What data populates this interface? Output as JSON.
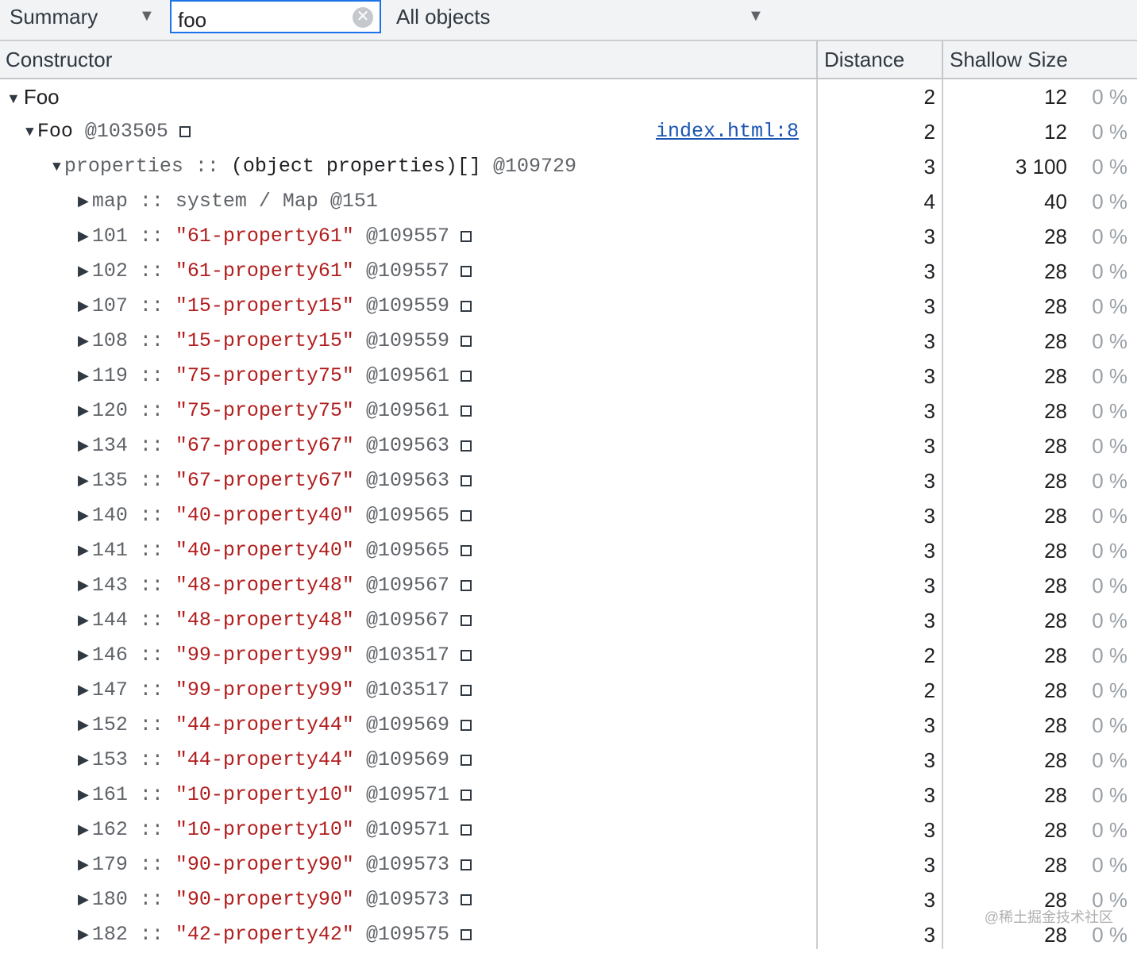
{
  "toolbar": {
    "view": "Summary",
    "filter_value": "foo",
    "class_filter": "All objects"
  },
  "columns": {
    "constructor": "Constructor",
    "distance": "Distance",
    "shallow_size": "Shallow Size"
  },
  "rows": [
    {
      "level": 0,
      "kind": "class",
      "expanded": true,
      "name": "Foo",
      "distance": "2",
      "size": "12",
      "pct": "0 %"
    },
    {
      "level": 1,
      "kind": "object",
      "expanded": true,
      "name": "Foo",
      "id": "@103505",
      "link": "index.html:8",
      "distance": "2",
      "size": "12",
      "pct": "0 %"
    },
    {
      "level": 2,
      "kind": "prop",
      "expanded": true,
      "key": "properties",
      "sep": " :: ",
      "value": "(object properties)[]",
      "value_color": "dark",
      "id": "@109729",
      "box": false,
      "distance": "3",
      "size": "3 100",
      "pct": "0 %"
    },
    {
      "level": 3,
      "kind": "prop",
      "expanded": false,
      "key": "map",
      "sep": " :: ",
      "value": "system / Map",
      "value_color": "grey",
      "id": "@151",
      "box": false,
      "distance": "4",
      "size": "40",
      "pct": "0 %"
    },
    {
      "level": 3,
      "kind": "prop",
      "expanded": false,
      "key": "101",
      "sep": " :: ",
      "value": "\"61-property61\"",
      "value_color": "red",
      "id": "@109557",
      "box": true,
      "distance": "3",
      "size": "28",
      "pct": "0 %"
    },
    {
      "level": 3,
      "kind": "prop",
      "expanded": false,
      "key": "102",
      "sep": " :: ",
      "value": "\"61-property61\"",
      "value_color": "red",
      "id": "@109557",
      "box": true,
      "distance": "3",
      "size": "28",
      "pct": "0 %"
    },
    {
      "level": 3,
      "kind": "prop",
      "expanded": false,
      "key": "107",
      "sep": " :: ",
      "value": "\"15-property15\"",
      "value_color": "red",
      "id": "@109559",
      "box": true,
      "distance": "3",
      "size": "28",
      "pct": "0 %"
    },
    {
      "level": 3,
      "kind": "prop",
      "expanded": false,
      "key": "108",
      "sep": " :: ",
      "value": "\"15-property15\"",
      "value_color": "red",
      "id": "@109559",
      "box": true,
      "distance": "3",
      "size": "28",
      "pct": "0 %"
    },
    {
      "level": 3,
      "kind": "prop",
      "expanded": false,
      "key": "119",
      "sep": " :: ",
      "value": "\"75-property75\"",
      "value_color": "red",
      "id": "@109561",
      "box": true,
      "distance": "3",
      "size": "28",
      "pct": "0 %"
    },
    {
      "level": 3,
      "kind": "prop",
      "expanded": false,
      "key": "120",
      "sep": " :: ",
      "value": "\"75-property75\"",
      "value_color": "red",
      "id": "@109561",
      "box": true,
      "distance": "3",
      "size": "28",
      "pct": "0 %"
    },
    {
      "level": 3,
      "kind": "prop",
      "expanded": false,
      "key": "134",
      "sep": " :: ",
      "value": "\"67-property67\"",
      "value_color": "red",
      "id": "@109563",
      "box": true,
      "distance": "3",
      "size": "28",
      "pct": "0 %"
    },
    {
      "level": 3,
      "kind": "prop",
      "expanded": false,
      "key": "135",
      "sep": " :: ",
      "value": "\"67-property67\"",
      "value_color": "red",
      "id": "@109563",
      "box": true,
      "distance": "3",
      "size": "28",
      "pct": "0 %"
    },
    {
      "level": 3,
      "kind": "prop",
      "expanded": false,
      "key": "140",
      "sep": " :: ",
      "value": "\"40-property40\"",
      "value_color": "red",
      "id": "@109565",
      "box": true,
      "distance": "3",
      "size": "28",
      "pct": "0 %"
    },
    {
      "level": 3,
      "kind": "prop",
      "expanded": false,
      "key": "141",
      "sep": " :: ",
      "value": "\"40-property40\"",
      "value_color": "red",
      "id": "@109565",
      "box": true,
      "distance": "3",
      "size": "28",
      "pct": "0 %"
    },
    {
      "level": 3,
      "kind": "prop",
      "expanded": false,
      "key": "143",
      "sep": " :: ",
      "value": "\"48-property48\"",
      "value_color": "red",
      "id": "@109567",
      "box": true,
      "distance": "3",
      "size": "28",
      "pct": "0 %"
    },
    {
      "level": 3,
      "kind": "prop",
      "expanded": false,
      "key": "144",
      "sep": " :: ",
      "value": "\"48-property48\"",
      "value_color": "red",
      "id": "@109567",
      "box": true,
      "distance": "3",
      "size": "28",
      "pct": "0 %"
    },
    {
      "level": 3,
      "kind": "prop",
      "expanded": false,
      "key": "146",
      "sep": " :: ",
      "value": "\"99-property99\"",
      "value_color": "red",
      "id": "@103517",
      "box": true,
      "distance": "2",
      "size": "28",
      "pct": "0 %"
    },
    {
      "level": 3,
      "kind": "prop",
      "expanded": false,
      "key": "147",
      "sep": " :: ",
      "value": "\"99-property99\"",
      "value_color": "red",
      "id": "@103517",
      "box": true,
      "distance": "2",
      "size": "28",
      "pct": "0 %"
    },
    {
      "level": 3,
      "kind": "prop",
      "expanded": false,
      "key": "152",
      "sep": " :: ",
      "value": "\"44-property44\"",
      "value_color": "red",
      "id": "@109569",
      "box": true,
      "distance": "3",
      "size": "28",
      "pct": "0 %"
    },
    {
      "level": 3,
      "kind": "prop",
      "expanded": false,
      "key": "153",
      "sep": " :: ",
      "value": "\"44-property44\"",
      "value_color": "red",
      "id": "@109569",
      "box": true,
      "distance": "3",
      "size": "28",
      "pct": "0 %"
    },
    {
      "level": 3,
      "kind": "prop",
      "expanded": false,
      "key": "161",
      "sep": " :: ",
      "value": "\"10-property10\"",
      "value_color": "red",
      "id": "@109571",
      "box": true,
      "distance": "3",
      "size": "28",
      "pct": "0 %"
    },
    {
      "level": 3,
      "kind": "prop",
      "expanded": false,
      "key": "162",
      "sep": " :: ",
      "value": "\"10-property10\"",
      "value_color": "red",
      "id": "@109571",
      "box": true,
      "distance": "3",
      "size": "28",
      "pct": "0 %"
    },
    {
      "level": 3,
      "kind": "prop",
      "expanded": false,
      "key": "179",
      "sep": " :: ",
      "value": "\"90-property90\"",
      "value_color": "red",
      "id": "@109573",
      "box": true,
      "distance": "3",
      "size": "28",
      "pct": "0 %"
    },
    {
      "level": 3,
      "kind": "prop",
      "expanded": false,
      "key": "180",
      "sep": " :: ",
      "value": "\"90-property90\"",
      "value_color": "red",
      "id": "@109573",
      "box": true,
      "distance": "3",
      "size": "28",
      "pct": "0 %"
    },
    {
      "level": 3,
      "kind": "prop",
      "expanded": false,
      "key": "182",
      "sep": " :: ",
      "value": "\"42-property42\"",
      "value_color": "red",
      "id": "@109575",
      "box": true,
      "distance": "3",
      "size": "28",
      "pct": "0 %"
    }
  ],
  "watermark": "@稀土掘金技术社区",
  "icons": {
    "expanded": "triangle-down-icon",
    "collapsed": "triangle-right-icon",
    "clear": "clear-icon",
    "reveal": "square-icon"
  },
  "colors": {
    "accent": "#1a73e8",
    "string_value": "#b21d1d",
    "link": "#1a55b3"
  }
}
